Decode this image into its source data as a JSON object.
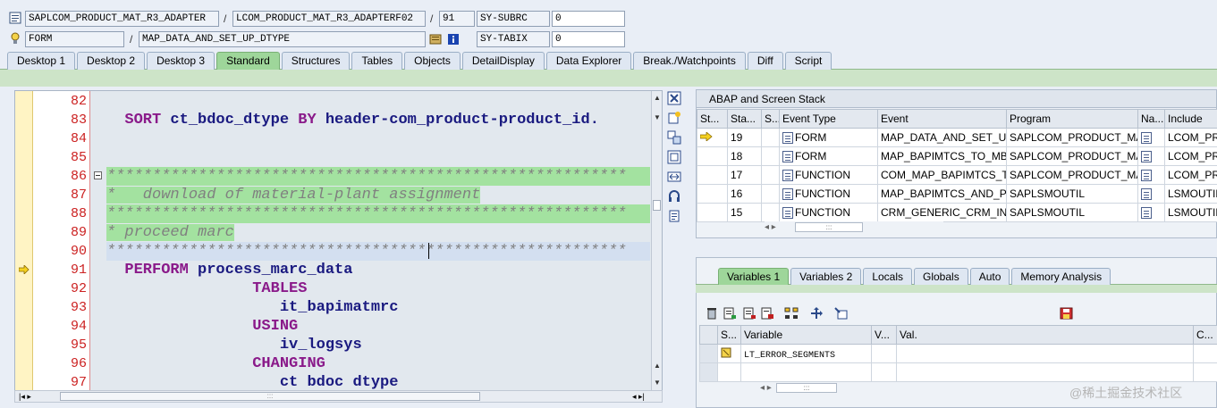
{
  "header": {
    "row1": {
      "program": "SAPLCOM_PRODUCT_MAT_R3_ADAPTER",
      "include": "LCOM_PRODUCT_MAT_R3_ADAPTERF02",
      "line": "91",
      "sysvar_label": "SY-SUBRC",
      "sysvar_value": "0"
    },
    "row2": {
      "event_type": "FORM",
      "event_name": "MAP_DATA_AND_SET_UP_DTYPE",
      "sysvar_label": "SY-TABIX",
      "sysvar_value": "0"
    },
    "separator": "/"
  },
  "tabs": [
    "Desktop 1",
    "Desktop 2",
    "Desktop 3",
    "Standard",
    "Structures",
    "Tables",
    "Objects",
    "DetailDisplay",
    "Data Explorer",
    "Break./Watchpoints",
    "Diff",
    "Script"
  ],
  "active_tab": "Standard",
  "editor": {
    "lines": [
      {
        "n": "82",
        "parts": [
          {
            "t": "",
            "c": ""
          }
        ]
      },
      {
        "n": "83",
        "parts": [
          {
            "t": "  ",
            "c": ""
          },
          {
            "t": "SORT",
            "c": "kw"
          },
          {
            "t": " ct_bdoc_dtype ",
            "c": "id"
          },
          {
            "t": "BY",
            "c": "kw"
          },
          {
            "t": " header-com_product-product_id.",
            "c": "id"
          }
        ]
      },
      {
        "n": "84",
        "parts": [
          {
            "t": "",
            "c": ""
          }
        ]
      },
      {
        "n": "85",
        "parts": [
          {
            "t": "",
            "c": ""
          }
        ]
      },
      {
        "n": "86",
        "parts": [
          {
            "t": "*********************************************************",
            "c": "cmt"
          }
        ],
        "hl": "full"
      },
      {
        "n": "87",
        "parts": [
          {
            "t": "*   download of material-plant assignment",
            "c": "cmt"
          }
        ],
        "hl": "text"
      },
      {
        "n": "88",
        "parts": [
          {
            "t": "*********************************************************",
            "c": "cmt"
          }
        ],
        "hl": "full"
      },
      {
        "n": "89",
        "parts": [
          {
            "t": "* proceed marc",
            "c": "cmt"
          }
        ],
        "hl": "text"
      },
      {
        "n": "90",
        "parts": [
          {
            "t": "*********************************************************",
            "c": "cmt"
          }
        ],
        "hl": "blue"
      },
      {
        "n": "91",
        "parts": [
          {
            "t": "  ",
            "c": ""
          },
          {
            "t": "PERFORM",
            "c": "kw"
          },
          {
            "t": " process_marc_data",
            "c": "id"
          }
        ],
        "current": true
      },
      {
        "n": "92",
        "parts": [
          {
            "t": "                ",
            "c": ""
          },
          {
            "t": "TABLES",
            "c": "kw"
          }
        ]
      },
      {
        "n": "93",
        "parts": [
          {
            "t": "                   ",
            "c": ""
          },
          {
            "t": "it_bapimatmrc",
            "c": "id"
          }
        ]
      },
      {
        "n": "94",
        "parts": [
          {
            "t": "                ",
            "c": ""
          },
          {
            "t": "USING",
            "c": "kw"
          }
        ]
      },
      {
        "n": "95",
        "parts": [
          {
            "t": "                   ",
            "c": ""
          },
          {
            "t": "iv_logsys",
            "c": "id"
          }
        ]
      },
      {
        "n": "96",
        "parts": [
          {
            "t": "                ",
            "c": ""
          },
          {
            "t": "CHANGING",
            "c": "kw"
          }
        ]
      },
      {
        "n": "97",
        "parts": [
          {
            "t": "                   ",
            "c": ""
          },
          {
            "t": "ct bdoc dtype",
            "c": "id"
          }
        ]
      }
    ]
  },
  "stack": {
    "title": "ABAP and Screen Stack",
    "columns": [
      "St...",
      "Sta...",
      "S...",
      "Event Type",
      "Event",
      "Program",
      "Na...",
      "Include"
    ],
    "rows": [
      {
        "current": true,
        "level": "19",
        "type": "FORM",
        "event": "MAP_DATA_AND_SET_U...",
        "program": "SAPLCOM_PRODUCT_MA...",
        "include": "LCOM_PRO"
      },
      {
        "current": false,
        "level": "18",
        "type": "FORM",
        "event": "MAP_BAPIMTCS_TO_MB...",
        "program": "SAPLCOM_PRODUCT_MA...",
        "include": "LCOM_PRO"
      },
      {
        "current": false,
        "level": "17",
        "type": "FUNCTION",
        "event": "COM_MAP_BAPIMTCS_T...",
        "program": "SAPLCOM_PRODUCT_MA...",
        "include": "LCOM_PRO"
      },
      {
        "current": false,
        "level": "16",
        "type": "FUNCTION",
        "event": "MAP_BAPIMTCS_AND_P...",
        "program": "SAPLSMOUTIL",
        "include": "LSMOUTIL"
      },
      {
        "current": false,
        "level": "15",
        "type": "FUNCTION",
        "event": "CRM_GENERIC_CRM_IN",
        "program": "SAPLSMOUTIL",
        "include": "LSMOUTIL"
      }
    ]
  },
  "var_tabs": [
    "Variables 1",
    "Variables 2",
    "Locals",
    "Globals",
    "Auto",
    "Memory Analysis"
  ],
  "active_var_tab": "Variables 1",
  "variables": {
    "columns": [
      "S...",
      "Variable",
      "V...",
      "Val.",
      "C..."
    ],
    "rows": [
      {
        "variable": "LT_ERROR_SEGMENTS",
        "value": ""
      }
    ]
  },
  "watermark": "@稀土掘金技术社区",
  "scroll_grip": ":::",
  "colors": {
    "tab_active": "#9ed69a",
    "line_number": "#cc2222",
    "keyword": "#8a1a8a",
    "identifier": "#1a1a80",
    "comment_highlight": "#a3e2a0"
  }
}
